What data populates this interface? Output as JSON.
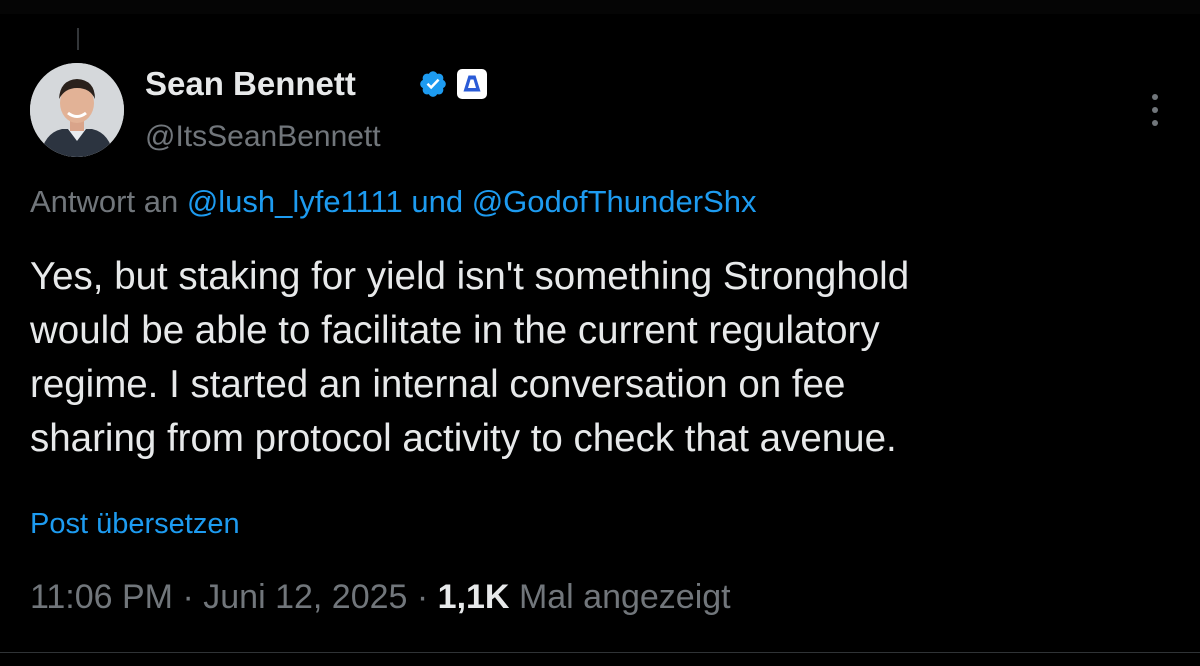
{
  "author": {
    "display_name": "Sean Bennett",
    "handle": "@ItsSeanBennett"
  },
  "reply": {
    "prefix": "Antwort an",
    "mentions": [
      "@lush_lyfe1111",
      "@GodofThunderShx"
    ],
    "conjunction": "und"
  },
  "tweet": {
    "text_lines": [
      "Yes, but staking for yield isn't something Stronghold",
      "would be able to facilitate in the current regulatory",
      "regime. I started an internal conversation on fee",
      "sharing from protocol activity to check that avenue."
    ]
  },
  "translate_label": "Post übersetzen",
  "meta": {
    "time": "11:06 PM",
    "date": "Juni 12, 2025",
    "separator": "·",
    "views_count": "1,1K",
    "views_label": "Mal angezeigt"
  },
  "icons": {
    "verified": "verified-badge-icon",
    "affiliate": "affiliate-badge-icon",
    "more": "more-options-icon"
  },
  "colors": {
    "background": "#000000",
    "primary_text": "#e7e9ea",
    "secondary_text": "#71767b",
    "link": "#1d9bf0"
  }
}
